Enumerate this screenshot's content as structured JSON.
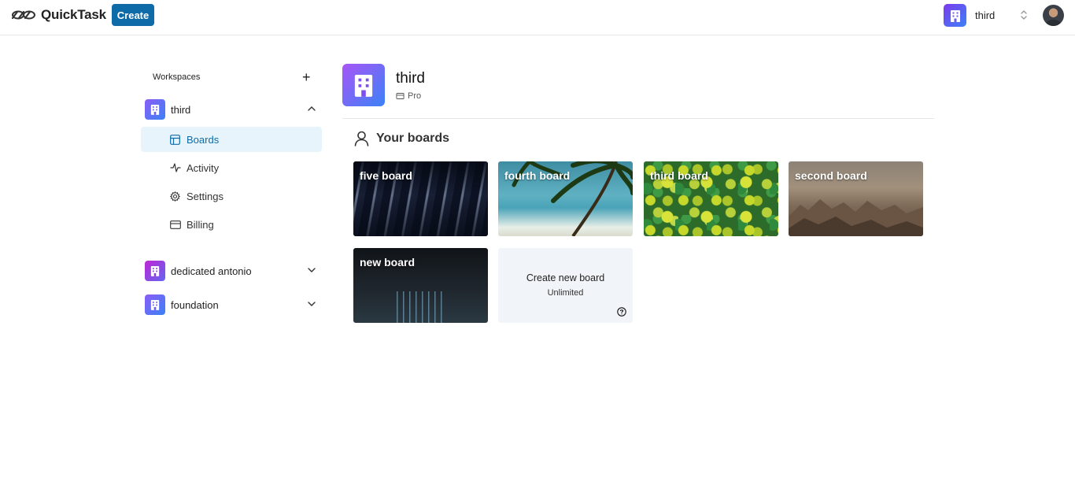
{
  "brand": {
    "name": "QuickTask",
    "logo_icon": "infinity-link-icon",
    "accent": "#0e6ba8"
  },
  "topbar": {
    "create_label": "Create",
    "workspace_switcher_name": "third"
  },
  "sidebar": {
    "header_label": "Workspaces",
    "workspaces": [
      {
        "name": "third",
        "expanded": true
      },
      {
        "name": "dedicated antonio",
        "expanded": false
      },
      {
        "name": "foundation",
        "expanded": false
      }
    ],
    "nav": [
      {
        "label": "Boards",
        "icon": "layout-icon",
        "active": true
      },
      {
        "label": "Activity",
        "icon": "activity-icon",
        "active": false
      },
      {
        "label": "Settings",
        "icon": "gear-icon",
        "active": false
      },
      {
        "label": "Billing",
        "icon": "credit-card-icon",
        "active": false
      }
    ]
  },
  "workspace": {
    "name": "third",
    "plan": "Pro"
  },
  "boards": {
    "heading": "Your boards",
    "items": [
      {
        "title": "five board"
      },
      {
        "title": "fourth board"
      },
      {
        "title": "third board"
      },
      {
        "title": "second board"
      },
      {
        "title": "new board"
      }
    ],
    "create": {
      "title": "Create new board",
      "subtitle": "Unlimited"
    }
  }
}
